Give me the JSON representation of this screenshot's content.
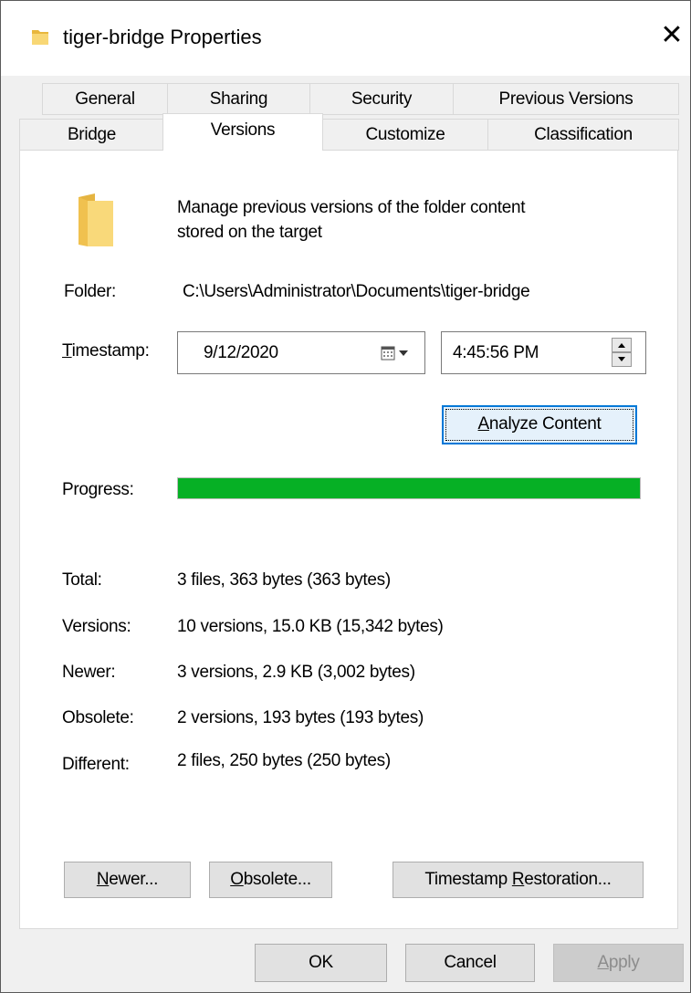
{
  "window": {
    "title": "tiger-bridge Properties",
    "close_glyph": "✕"
  },
  "tabs": {
    "row1": [
      {
        "label": "General"
      },
      {
        "label": "Sharing"
      },
      {
        "label": "Security"
      },
      {
        "label": "Previous Versions"
      }
    ],
    "row2": [
      {
        "label": "Bridge"
      },
      {
        "label": "Versions",
        "active": true
      },
      {
        "label": "Customize"
      },
      {
        "label": "Classification"
      }
    ]
  },
  "versions_tab": {
    "description_line1": "Manage previous versions of the folder content",
    "description_line2": "stored on the target",
    "folder_label": "Folder:",
    "folder_path": "C:\\Users\\Administrator\\Documents\\tiger-bridge",
    "timestamp_label_key": "T",
    "timestamp_label_rest": "imestamp:",
    "date_value": "9/12/2020",
    "time_value": "4:45:56 PM",
    "analyze_key": "A",
    "analyze_rest": "nalyze Content",
    "progress_label": "Progress:",
    "progress_fraction": 1.0,
    "progress_color": "#06b025",
    "stats": [
      {
        "label": "Total:",
        "value": "3 files, 363 bytes (363 bytes)"
      },
      {
        "label": "Versions:",
        "value": "10 versions, 15.0 KB (15,342 bytes)"
      },
      {
        "label": "Newer:",
        "value": "3 versions, 2.9 KB (3,002 bytes)"
      },
      {
        "label": "Obsolete:",
        "value": "2 versions, 193 bytes (193 bytes)"
      },
      {
        "label": "Different:",
        "value": "2 files, 250 bytes (250 bytes)"
      }
    ],
    "newer_key": "N",
    "newer_rest": "ewer...",
    "obsolete_key": "O",
    "obsolete_rest": "bsolete...",
    "restore_pre": "Timestamp ",
    "restore_key": "R",
    "restore_rest": "estoration..."
  },
  "dialog_buttons": {
    "ok": "OK",
    "cancel": "Cancel",
    "apply_key": "A",
    "apply_rest": "pply"
  },
  "icons": {
    "folder": "folder-icon",
    "calendar": "calendar-dropdown-icon",
    "spin_up": "spin-up-icon",
    "spin_down": "spin-down-icon",
    "close": "close-icon"
  }
}
